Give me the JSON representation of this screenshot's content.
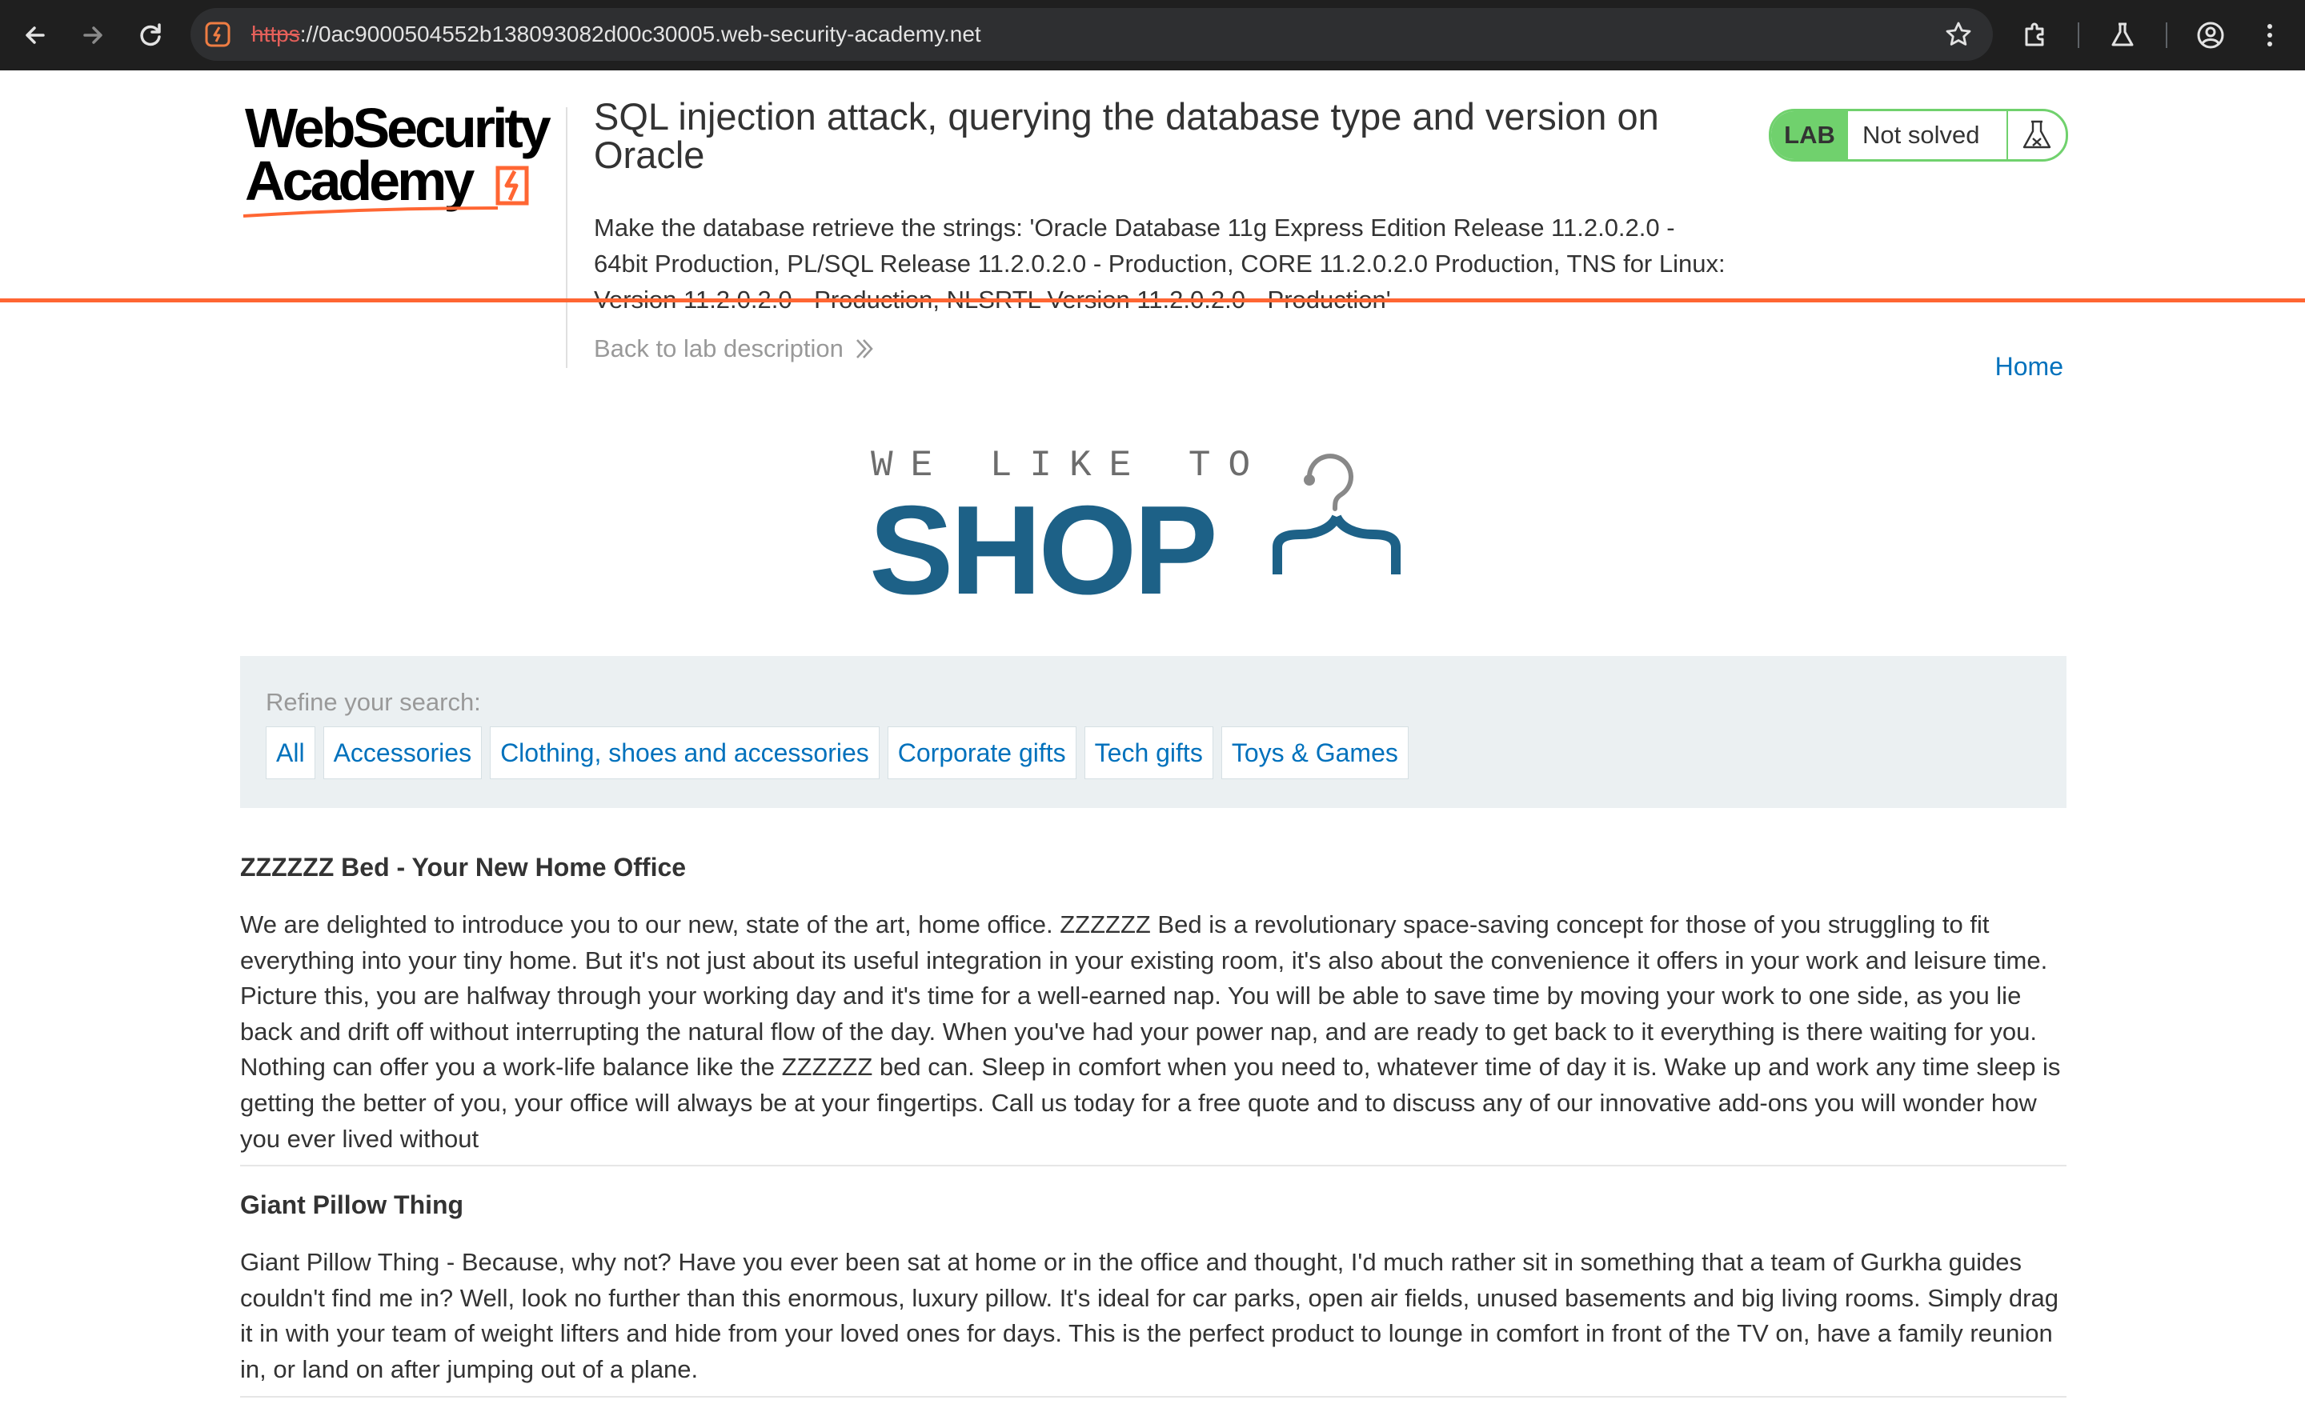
{
  "browser": {
    "url_protocol": "https",
    "url_rest": "://0ac9000504552b138093082d00c30005.web-security-academy.net",
    "icons": [
      "back-arrow-icon",
      "forward-arrow-icon",
      "reload-icon",
      "site-info-icon",
      "bookmark-star-icon",
      "extensions-icon",
      "labs-flask-icon",
      "profile-icon",
      "menu-kebab-icon"
    ]
  },
  "academy": {
    "logo_line1": "WebSecurity",
    "logo_line2": "Academy",
    "lab_title": "SQL injection attack, querying the database type and version on Oracle",
    "lab_description": "Make the database retrieve the strings: 'Oracle Database 11g Express Edition Release 11.2.0.2.0 - 64bit Production, PL/SQL Release 11.2.0.2.0 - Production, CORE 11.2.0.2.0 Production, TNS for Linux: Version 11.2.0.2.0 - Production, NLSRTL Version 11.2.0.2.0 - Production'",
    "back_link": "Back to lab description",
    "lab_badge": "LAB",
    "lab_state": "Not solved",
    "accent_color": "#ff6633",
    "status_color": "#70d16d"
  },
  "nav": {
    "home": "Home"
  },
  "shop_logo": {
    "top": "WE LIKE TO",
    "main": "SHOP"
  },
  "filter": {
    "label": "Refine your search:",
    "categories": [
      "All",
      "Accessories",
      "Clothing, shoes and accessories",
      "Corporate gifts",
      "Tech gifts",
      "Toys & Games"
    ]
  },
  "products": [
    {
      "name": "ZZZZZZ Bed - Your New Home Office",
      "description": "We are delighted to introduce you to our new, state of the art, home office. ZZZZZZ Bed is a revolutionary space-saving concept for those of you struggling to fit everything into your tiny home. But it's not just about its useful integration in your existing room, it's also about the convenience it offers in your work and leisure time. Picture this, you are halfway through your working day and it's time for a well-earned nap. You will be able to save time by moving your work to one side, as you lie back and drift off without interrupting the natural flow of the day. When you've had your power nap, and are ready to get back to it everything is there waiting for you. Nothing can offer you a work-life balance like the ZZZZZZ bed can. Sleep in comfort when you need to, whatever time of day it is. Wake up and work any time sleep is getting the better of you, your office will always be at your fingertips. Call us today for a free quote and to discuss any of our innovative add-ons you will wonder how you ever lived without"
    },
    {
      "name": "Giant Pillow Thing",
      "description": "Giant Pillow Thing - Because, why not? Have you ever been sat at home or in the office and thought, I'd much rather sit in something that a team of Gurkha guides couldn't find me in? Well, look no further than this enormous, luxury pillow. It's ideal for car parks, open air fields, unused basements and big living rooms. Simply drag it in with your team of weight lifters and hide from your loved ones for days. This is the perfect product to lounge in comfort in front of the TV on, have a family reunion in, or land on after jumping out of a plane."
    }
  ]
}
